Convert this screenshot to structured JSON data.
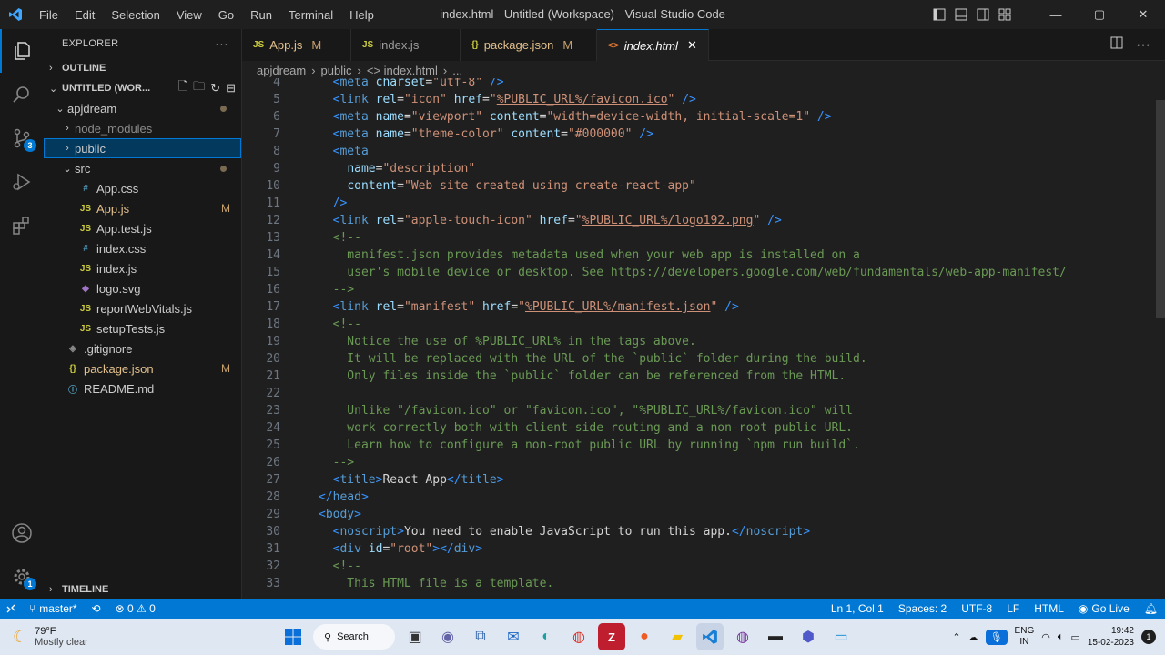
{
  "window": {
    "title": "index.html - Untitled (Workspace) - Visual Studio Code"
  },
  "menu": [
    "File",
    "Edit",
    "Selection",
    "View",
    "Go",
    "Run",
    "Terminal",
    "Help"
  ],
  "activity": {
    "scm_badge": "3",
    "settings_badge": "1"
  },
  "sidebar": {
    "title": "EXPLORER",
    "outline": "OUTLINE",
    "workspace": "UNTITLED (WOR...",
    "timeline": "TIMELINE",
    "tree": [
      {
        "label": "apjdream",
        "type": "folder",
        "open": true,
        "depth": 1,
        "status": "dot"
      },
      {
        "label": "node_modules",
        "type": "folder",
        "open": false,
        "depth": 2,
        "dim": true
      },
      {
        "label": "public",
        "type": "folder",
        "open": false,
        "depth": 2,
        "selected": true
      },
      {
        "label": "src",
        "type": "folder",
        "open": true,
        "depth": 2,
        "status": "dot"
      },
      {
        "label": "App.css",
        "icon": "#",
        "cls": "css",
        "depth": 3
      },
      {
        "label": "App.js",
        "icon": "JS",
        "cls": "js",
        "depth": 3,
        "status": "M"
      },
      {
        "label": "App.test.js",
        "icon": "JS",
        "cls": "js",
        "depth": 3
      },
      {
        "label": "index.css",
        "icon": "#",
        "cls": "css",
        "depth": 3
      },
      {
        "label": "index.js",
        "icon": "JS",
        "cls": "js",
        "depth": 3
      },
      {
        "label": "logo.svg",
        "icon": "◆",
        "cls": "svg",
        "depth": 3
      },
      {
        "label": "reportWebVitals.js",
        "icon": "JS",
        "cls": "js",
        "depth": 3
      },
      {
        "label": "setupTests.js",
        "icon": "JS",
        "cls": "js",
        "depth": 3
      },
      {
        "label": ".gitignore",
        "icon": "◈",
        "cls": "gi",
        "depth": 2
      },
      {
        "label": "package.json",
        "icon": "{}",
        "cls": "json",
        "depth": 2,
        "status": "M"
      },
      {
        "label": "README.md",
        "icon": "ⓘ",
        "cls": "md",
        "depth": 2
      }
    ]
  },
  "tabs": [
    {
      "label": "App.js",
      "icon": "JS",
      "status": "M"
    },
    {
      "label": "index.js",
      "icon": "JS"
    },
    {
      "label": "package.json",
      "icon": "{}",
      "status": "M"
    },
    {
      "label": "index.html",
      "icon": "<>",
      "active": true,
      "close": "✕"
    }
  ],
  "breadcrumb": [
    "apjdream",
    "›",
    "public",
    "›",
    "<> index.html",
    "›",
    "..."
  ],
  "code": [
    {
      "n": "4",
      "t": [
        [
          "  ",
          ""
        ],
        [
          "<",
          "tg"
        ],
        [
          "meta ",
          "tn"
        ],
        [
          "charset",
          "at"
        ],
        [
          "=",
          "tx"
        ],
        [
          "\"utf-8\"",
          "st"
        ],
        [
          " />",
          "tg"
        ]
      ]
    },
    {
      "n": "5",
      "t": [
        [
          "  ",
          ""
        ],
        [
          "<",
          "tg"
        ],
        [
          "link ",
          "tn"
        ],
        [
          "rel",
          "at"
        ],
        [
          "=",
          "tx"
        ],
        [
          "\"icon\" ",
          "st"
        ],
        [
          "href",
          "at"
        ],
        [
          "=",
          "tx"
        ],
        [
          "\"",
          "st"
        ],
        [
          "%PUBLIC_URL%/favicon.ico",
          "ul"
        ],
        [
          "\"",
          "st"
        ],
        [
          " />",
          "tg"
        ]
      ]
    },
    {
      "n": "6",
      "t": [
        [
          "  ",
          ""
        ],
        [
          "<",
          "tg"
        ],
        [
          "meta ",
          "tn"
        ],
        [
          "name",
          "at"
        ],
        [
          "=",
          "tx"
        ],
        [
          "\"viewport\" ",
          "st"
        ],
        [
          "content",
          "at"
        ],
        [
          "=",
          "tx"
        ],
        [
          "\"width=device-width, initial-scale=1\"",
          "st"
        ],
        [
          " />",
          "tg"
        ]
      ]
    },
    {
      "n": "7",
      "t": [
        [
          "  ",
          ""
        ],
        [
          "<",
          "tg"
        ],
        [
          "meta ",
          "tn"
        ],
        [
          "name",
          "at"
        ],
        [
          "=",
          "tx"
        ],
        [
          "\"theme-color\" ",
          "st"
        ],
        [
          "content",
          "at"
        ],
        [
          "=",
          "tx"
        ],
        [
          "\"#000000\"",
          "st"
        ],
        [
          " />",
          "tg"
        ]
      ]
    },
    {
      "n": "8",
      "t": [
        [
          "  ",
          ""
        ],
        [
          "<",
          "tg"
        ],
        [
          "meta",
          "tn"
        ]
      ]
    },
    {
      "n": "9",
      "t": [
        [
          "    ",
          ""
        ],
        [
          "name",
          "at"
        ],
        [
          "=",
          "tx"
        ],
        [
          "\"description\"",
          "st"
        ]
      ]
    },
    {
      "n": "10",
      "t": [
        [
          "    ",
          ""
        ],
        [
          "content",
          "at"
        ],
        [
          "=",
          "tx"
        ],
        [
          "\"Web site created using create-react-app\"",
          "st"
        ]
      ]
    },
    {
      "n": "11",
      "t": [
        [
          "  ",
          ""
        ],
        [
          "/>",
          "tg"
        ]
      ]
    },
    {
      "n": "12",
      "t": [
        [
          "  ",
          ""
        ],
        [
          "<",
          "tg"
        ],
        [
          "link ",
          "tn"
        ],
        [
          "rel",
          "at"
        ],
        [
          "=",
          "tx"
        ],
        [
          "\"apple-touch-icon\" ",
          "st"
        ],
        [
          "href",
          "at"
        ],
        [
          "=",
          "tx"
        ],
        [
          "\"",
          "st"
        ],
        [
          "%PUBLIC_URL%/logo192.png",
          "ul"
        ],
        [
          "\"",
          "st"
        ],
        [
          " />",
          "tg"
        ]
      ]
    },
    {
      "n": "13",
      "t": [
        [
          "  ",
          ""
        ],
        [
          "<!--",
          "cm"
        ]
      ]
    },
    {
      "n": "14",
      "t": [
        [
          "    manifest.json provides metadata used when your web app is installed on a",
          "cm"
        ]
      ]
    },
    {
      "n": "15",
      "t": [
        [
          "    user's mobile device or desktop. See ",
          "cm"
        ],
        [
          "https://developers.google.com/web/fundamentals/web-app-manifest/",
          "lk"
        ]
      ]
    },
    {
      "n": "16",
      "t": [
        [
          "  -->",
          "cm"
        ]
      ]
    },
    {
      "n": "17",
      "t": [
        [
          "  ",
          ""
        ],
        [
          "<",
          "tg"
        ],
        [
          "link ",
          "tn"
        ],
        [
          "rel",
          "at"
        ],
        [
          "=",
          "tx"
        ],
        [
          "\"manifest\" ",
          "st"
        ],
        [
          "href",
          "at"
        ],
        [
          "=",
          "tx"
        ],
        [
          "\"",
          "st"
        ],
        [
          "%PUBLIC_URL%/manifest.json",
          "ul"
        ],
        [
          "\"",
          "st"
        ],
        [
          " />",
          "tg"
        ]
      ]
    },
    {
      "n": "18",
      "t": [
        [
          "  <!--",
          "cm"
        ]
      ]
    },
    {
      "n": "19",
      "t": [
        [
          "    Notice the use of %PUBLIC_URL% in the tags above.",
          "cm"
        ]
      ]
    },
    {
      "n": "20",
      "t": [
        [
          "    It will be replaced with the URL of the `public` folder during the build.",
          "cm"
        ]
      ]
    },
    {
      "n": "21",
      "t": [
        [
          "    Only files inside the `public` folder can be referenced from the HTML.",
          "cm"
        ]
      ]
    },
    {
      "n": "22",
      "t": [
        [
          "",
          ""
        ]
      ]
    },
    {
      "n": "23",
      "t": [
        [
          "    Unlike \"/favicon.ico\" or \"favicon.ico\", \"%PUBLIC_URL%/favicon.ico\" will",
          "cm"
        ]
      ]
    },
    {
      "n": "24",
      "t": [
        [
          "    work correctly both with client-side routing and a non-root public URL.",
          "cm"
        ]
      ]
    },
    {
      "n": "25",
      "t": [
        [
          "    Learn how to configure a non-root public URL by running `npm run build`.",
          "cm"
        ]
      ]
    },
    {
      "n": "26",
      "t": [
        [
          "  -->",
          "cm"
        ]
      ]
    },
    {
      "n": "27",
      "t": [
        [
          "  ",
          ""
        ],
        [
          "<",
          "tg"
        ],
        [
          "title",
          "tn"
        ],
        [
          ">",
          "tg"
        ],
        [
          "React App",
          "tx"
        ],
        [
          "</",
          "tg"
        ],
        [
          "title",
          "tn"
        ],
        [
          ">",
          "tg"
        ]
      ]
    },
    {
      "n": "28",
      "t": [
        [
          "</",
          "tg"
        ],
        [
          "head",
          "tn"
        ],
        [
          ">",
          "tg"
        ]
      ]
    },
    {
      "n": "29",
      "t": [
        [
          "<",
          "tg"
        ],
        [
          "body",
          "tn"
        ],
        [
          ">",
          "tg"
        ]
      ]
    },
    {
      "n": "30",
      "t": [
        [
          "  ",
          ""
        ],
        [
          "<",
          "tg"
        ],
        [
          "noscript",
          "tn"
        ],
        [
          ">",
          "tg"
        ],
        [
          "You need to enable JavaScript to run this app.",
          "tx"
        ],
        [
          "</",
          "tg"
        ],
        [
          "noscript",
          "tn"
        ],
        [
          ">",
          "tg"
        ]
      ]
    },
    {
      "n": "31",
      "t": [
        [
          "  ",
          ""
        ],
        [
          "<",
          "tg"
        ],
        [
          "div ",
          "tn"
        ],
        [
          "id",
          "at"
        ],
        [
          "=",
          "tx"
        ],
        [
          "\"root\"",
          "st"
        ],
        [
          "></",
          "tg"
        ],
        [
          "div",
          "tn"
        ],
        [
          ">",
          "tg"
        ]
      ]
    },
    {
      "n": "32",
      "t": [
        [
          "  <!--",
          "cm"
        ]
      ]
    },
    {
      "n": "33",
      "t": [
        [
          "    This HTML file is a template.",
          "cm"
        ]
      ]
    }
  ],
  "statusbar": {
    "branch": "master*",
    "errors": "0",
    "warnings": "0",
    "position": "Ln 1, Col 1",
    "spaces": "Spaces: 2",
    "encoding": "UTF-8",
    "eol": "LF",
    "language": "HTML",
    "golive": "Go Live"
  },
  "taskbar": {
    "weather_temp": "79°F",
    "weather_desc": "Mostly clear",
    "search": "Search",
    "lang1": "ENG",
    "lang2": "IN",
    "time": "19:42",
    "date": "15-02-2023"
  }
}
